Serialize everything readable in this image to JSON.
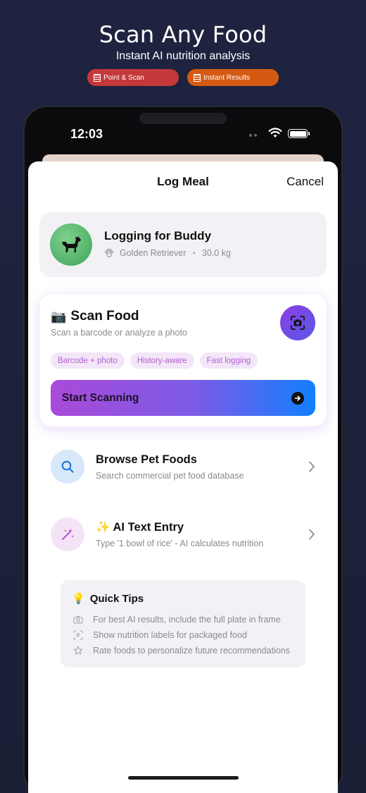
{
  "promo": {
    "title": "Scan Any Food",
    "subtitle": "Instant AI nutrition analysis",
    "pills": [
      "Point & Scan",
      "Instant Results"
    ]
  },
  "status_bar": {
    "time": "12:03"
  },
  "sheet": {
    "title": "Log Meal",
    "cancel_label": "Cancel"
  },
  "pet": {
    "logging_label": "Logging for Buddy",
    "breed": "Golden Retriever",
    "weight": "30.0 kg"
  },
  "scan": {
    "emoji": "📷",
    "title": "Scan Food",
    "subtitle": "Scan a barcode or analyze a photo",
    "chips": [
      "Barcode + photo",
      "History-aware",
      "Fast logging"
    ],
    "button_label": "Start Scanning"
  },
  "options": [
    {
      "title": "Browse Pet Foods",
      "subtitle": "Search commercial pet food database",
      "icon": "search-icon"
    },
    {
      "title": "✨ AI Text Entry",
      "subtitle": "Type '1 bowl of rice' - AI calculates nutrition",
      "icon": "magic-wand-icon"
    }
  ],
  "tips": {
    "emoji": "💡",
    "title": "Quick Tips",
    "items": [
      "For best AI results, include the full plate in frame",
      "Show nutrition labels for packaged food",
      "Rate foods to personalize future recommendations"
    ]
  },
  "colors": {
    "background": "#1f2340",
    "pill_red": "#c5383a",
    "pill_orange": "#d45a12",
    "accent_purple": "#a94ad9",
    "accent_blue": "#127fff",
    "chip_bg": "#f3e6f8",
    "chip_text": "#b261d0"
  }
}
